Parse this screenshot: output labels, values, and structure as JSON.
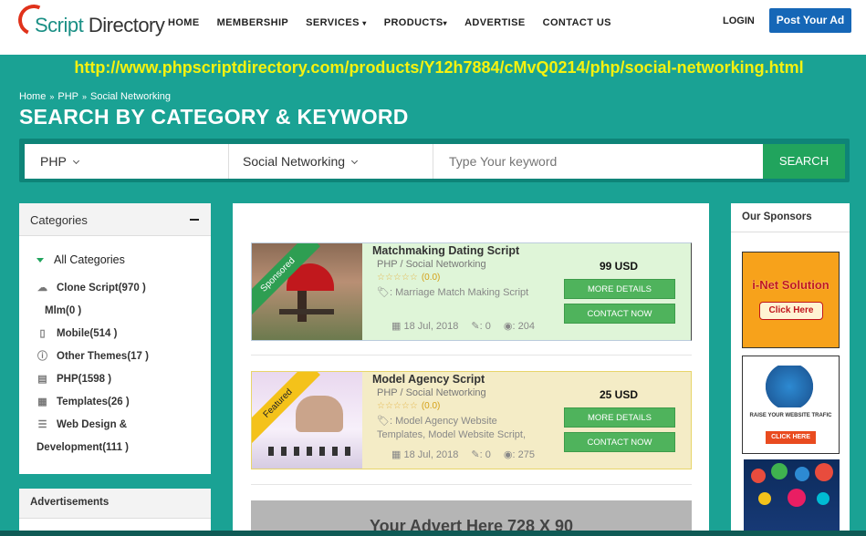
{
  "header": {
    "logo_script": "Script",
    "logo_directory": "Directory",
    "nav": [
      "HOME",
      "MEMBERSHIP",
      "SERVICES",
      "PRODUCTS",
      "ADVERTISE",
      "CONTACT US"
    ],
    "login": "LOGIN",
    "post_ad": "Post Your Ad"
  },
  "url_overlay": "http://www.phpscriptdirectory.com/products/Y12h7884/cMvQ0214/php/social-networking.html",
  "breadcrumb": [
    "Home",
    "PHP",
    "Social Networking"
  ],
  "page_title": "SEARCH BY CATEGORY & KEYWORD",
  "search": {
    "category": "PHP",
    "subcategory": "Social Networking",
    "placeholder": "Type Your keyword",
    "button": "SEARCH"
  },
  "categories": {
    "title": "Categories",
    "all": "All Categories",
    "items": [
      {
        "label": "Clone Script(970 )",
        "icon": "cloud-icon"
      },
      {
        "label": "Mlm(0 )",
        "icon": ""
      },
      {
        "label": "Mobile(514 )",
        "icon": "mobile-icon"
      },
      {
        "label": "Other Themes(17 )",
        "icon": "info-icon"
      },
      {
        "label": "PHP(1598 )",
        "icon": "php-file-icon"
      },
      {
        "label": "Templates(26 )",
        "icon": "document-icon"
      },
      {
        "label": "Web Design &",
        "icon": "server-icon"
      },
      {
        "label": "Development(111 )",
        "icon": ""
      }
    ]
  },
  "advertisements": {
    "title": "Advertisements"
  },
  "listings": [
    {
      "ribbon": "Sponsored",
      "title": "Matchmaking Dating Script",
      "category": "PHP / Social Networking",
      "stars": "☆☆☆☆☆",
      "rating": "(0.0)",
      "tags": ": Marriage Match Making Script",
      "date": "18 Jul, 2018",
      "comments": ": 0",
      "views": ": 204",
      "price": "99 USD",
      "more": "MORE DETAILS",
      "contact": "CONTACT NOW"
    },
    {
      "ribbon": "Featured",
      "title": "Model Agency Script",
      "category": "PHP / Social Networking",
      "stars": "☆☆☆☆☆",
      "rating": "(0.0)",
      "tags": ": Model Agency Website Templates, Model Website Script,",
      "date": "18 Jul, 2018",
      "comments": ": 0",
      "views": ": 275",
      "price": "25 USD",
      "more": "MORE DETAILS",
      "contact": "CONTACT NOW"
    }
  ],
  "banner": "Your Advert Here  728 X 90",
  "sponsors": {
    "title": "Our Sponsors",
    "ad1_title": "i-Net Solution",
    "ad1_button": "Click Here",
    "ad2_text": "RAISE YOUR WEBSITE TRAFIC",
    "ad2_button": "CLICK HERE"
  },
  "colors": {
    "page_bg": "#1aa294",
    "search_button": "#21a45d",
    "post_ad": "#1667b7",
    "url_text": "#f6f20f"
  }
}
